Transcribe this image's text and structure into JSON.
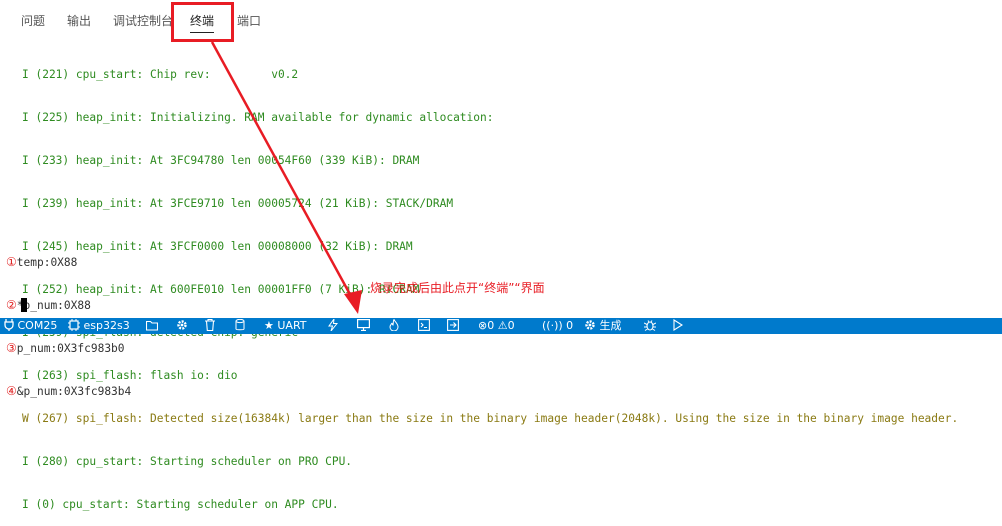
{
  "panel": {
    "tabs": [
      {
        "label": "问题",
        "active": false
      },
      {
        "label": "输出",
        "active": false
      },
      {
        "label": "调试控制台",
        "active": false
      },
      {
        "label": "终端",
        "active": true
      },
      {
        "label": "端口",
        "active": false
      }
    ]
  },
  "terminal": {
    "log_lines": [
      "I (221) cpu_start: Chip rev:         v0.2",
      "I (225) heap_init: Initializing. RAM available for dynamic allocation:",
      "I (233) heap_init: At 3FC94780 len 00054F60 (339 KiB): DRAM",
      "I (239) heap_init: At 3FCE9710 len 00005724 (21 KiB): STACK/DRAM",
      "I (245) heap_init: At 3FCF0000 len 00008000 (32 KiB): DRAM",
      "I (252) heap_init: At 600FE010 len 00001FF0 (7 KiB): RTCRAM",
      "I (259) spi_flash: detected chip: generic",
      "I (263) spi_flash: flash io: dio",
      "W (267) spi_flash: Detected size(16384k) larger than the size in the binary image header(2048k). Using the size in the binary image header.",
      "I (280) cpu_start: Starting scheduler on PRO CPU.",
      "I (0) cpu_start: Starting scheduler on APP CPU."
    ],
    "program_output": [
      {
        "marker": "①",
        "text": "temp:0X88"
      },
      {
        "marker": "②",
        "text": "*p_num:0X88"
      },
      {
        "marker": "③",
        "text": "p_num:0X3fc983b0"
      },
      {
        "marker": "④",
        "text": "&p_num:0X3fc983b4"
      }
    ]
  },
  "annotation": {
    "text": "烧录完成后由此点开“终端”“界面",
    "color": "#e81c24"
  },
  "statusbar": {
    "port": "COM25",
    "target": "esp32s3",
    "uart": "UART",
    "errors": "0",
    "warnings": "0",
    "remote": "0",
    "build": "生成",
    "background": "#007acc"
  },
  "icons": {
    "port": "plug-icon",
    "target": "chip-icon",
    "folder": "folder-icon",
    "settings": "gear-icon",
    "trash": "trash-icon",
    "database": "database-icon",
    "uart": "star-icon",
    "flash": "lightning-icon",
    "monitor": "monitor-icon",
    "flame": "flame-icon",
    "terminal": "terminal-icon",
    "debug_box": "export-icon",
    "remote": "broadcast-icon",
    "bug": "bug-icon",
    "run": "play-icon"
  }
}
